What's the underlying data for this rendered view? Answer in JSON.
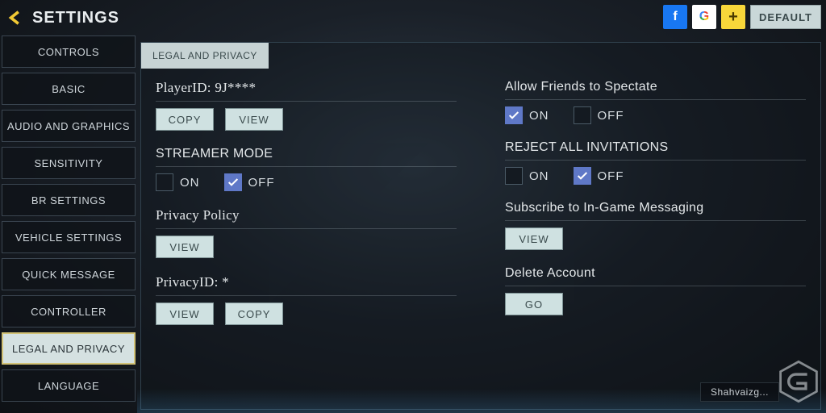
{
  "header": {
    "title": "SETTINGS",
    "default_label": "DEFAULT"
  },
  "sidebar": {
    "items": [
      "CONTROLS",
      "BASIC",
      "AUDIO AND GRAPHICS",
      "SENSITIVITY",
      "BR SETTINGS",
      "VEHICLE SETTINGS",
      "QUICK MESSAGE",
      "CONTROLLER",
      "LEGAL AND PRIVACY",
      "LANGUAGE"
    ],
    "active_index": 8
  },
  "subtab": "LEGAL AND PRIVACY",
  "labels": {
    "on": "ON",
    "off": "OFF",
    "copy": "COPY",
    "view": "VIEW",
    "go": "GO"
  },
  "left": {
    "player_id_title": "PlayerID: 9J****",
    "streamer_mode_title": "STREAMER MODE",
    "streamer_mode_value": "OFF",
    "privacy_policy_title": "Privacy Policy",
    "privacy_id_title": "PrivacyID: *"
  },
  "right": {
    "spectate_title": "Allow Friends to Spectate",
    "spectate_value": "ON",
    "reject_title": "REJECT ALL INVITATIONS",
    "reject_value": "OFF",
    "messaging_title": "Subscribe to In-Game Messaging",
    "delete_title": "Delete Account"
  },
  "credit": "Shahvaizg..."
}
